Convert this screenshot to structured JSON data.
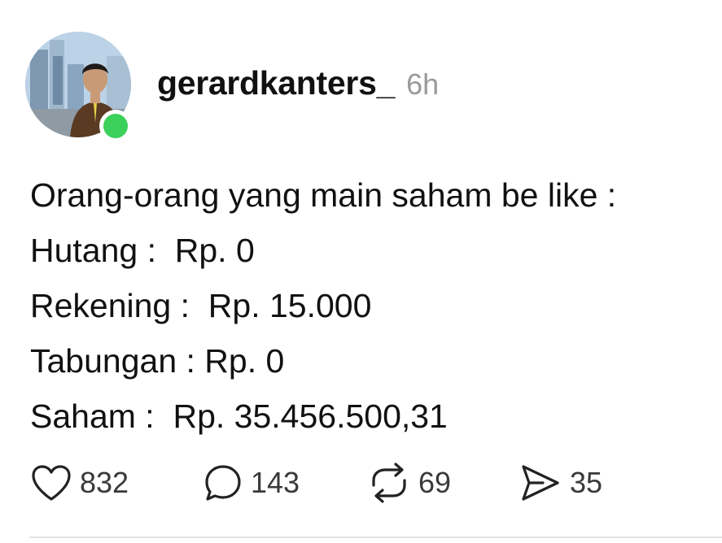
{
  "post": {
    "username": "gerardkanters_",
    "timestamp": "6h",
    "lines": [
      "Orang-orang yang main saham be like :",
      "Hutang :  Rp. 0",
      "Rekening :  Rp. 15.000",
      "Tabungan : Rp. 0",
      "Saham :  Rp. 35.456.500,31"
    ]
  },
  "actions": {
    "like": {
      "icon": "heart-icon",
      "count": "832"
    },
    "comment": {
      "icon": "speech-bubble-icon",
      "count": "143"
    },
    "repost": {
      "icon": "repost-icon",
      "count": "69"
    },
    "share": {
      "icon": "send-icon",
      "count": "35"
    }
  },
  "colors": {
    "online_indicator": "#3bd15b",
    "timestamp": "#9a9a9a",
    "text": "#111111",
    "count": "#3a3a3a"
  }
}
